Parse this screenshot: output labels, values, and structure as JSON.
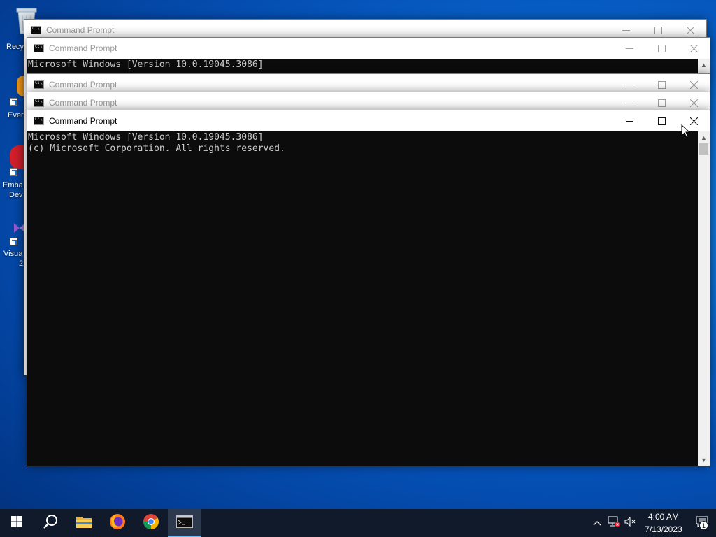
{
  "desktop": {
    "icons": [
      {
        "label": "Recyc",
        "icon": "recycle-bin-icon"
      },
      {
        "label": "Ever",
        "icon": "evernote-icon"
      },
      {
        "label": "Emba",
        "label2": "Dev",
        "icon": "embarcadero-dev-icon"
      },
      {
        "label": "Visua",
        "label2": "2",
        "icon": "visual-studio-icon"
      }
    ]
  },
  "windows": [
    {
      "title": "Command Prompt",
      "console": ""
    },
    {
      "title": "Command Prompt",
      "console": "Microsoft Windows [Version 10.0.19045.3086]"
    },
    {
      "title": "Command Prompt",
      "console": ""
    },
    {
      "title": "Command Prompt",
      "console": ""
    },
    {
      "title": "Command Prompt",
      "console": "Microsoft Windows [Version 10.0.19045.3086]\n(c) Microsoft Corporation. All rights reserved."
    }
  ],
  "taskbar": {
    "apps": [
      "start-icon",
      "search-icon",
      "file-explorer-icon",
      "firefox-icon",
      "chrome-icon",
      "command-prompt-icon"
    ],
    "clock": {
      "time": "4:00 AM",
      "date": "7/13/2023"
    },
    "notification_count": "1"
  },
  "colors": {
    "accent": "#76b9ed",
    "console_bg": "#0c0c0c",
    "console_fg": "#cccccc",
    "taskbar": "#101a2a"
  }
}
